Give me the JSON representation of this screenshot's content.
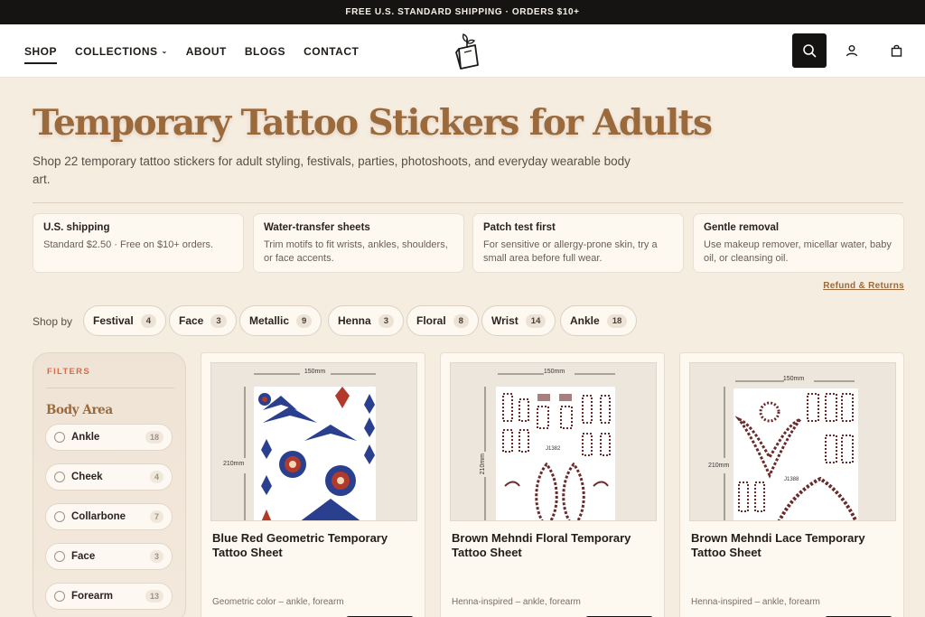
{
  "announcement": "FREE U.S. STANDARD SHIPPING · ORDERS $10+",
  "nav": {
    "items": [
      {
        "label": "SHOP",
        "active": true
      },
      {
        "label": "COLLECTIONS",
        "dropdown": true
      },
      {
        "label": "ABOUT"
      },
      {
        "label": "BLOGS"
      },
      {
        "label": "CONTACT"
      }
    ],
    "icons": {
      "search": "search-icon",
      "account": "user-icon",
      "cart": "bag-icon",
      "logo": "sticker-leaf-logo"
    }
  },
  "page": {
    "title": "Temporary Tattoo Stickers for Adults",
    "subtitle": "Shop 22 temporary tattoo stickers for adult styling, festivals, parties, photoshoots, and everyday wearable body art."
  },
  "info_cards": [
    {
      "title": "U.S. shipping",
      "text": "Standard $2.50 · Free on $10+ orders."
    },
    {
      "title": "Water-transfer sheets",
      "text": "Trim motifs to fit wrists, ankles, shoulders, or face accents."
    },
    {
      "title": "Patch test first",
      "text": "For sensitive or allergy-prone skin, try a small area before full wear."
    },
    {
      "title": "Gentle removal",
      "text": "Use makeup remover, micellar water, baby oil, or cleansing oil."
    }
  ],
  "refund_link": "Refund & Returns",
  "shop_by": {
    "label": "Shop by",
    "chips": [
      {
        "label": "Festival",
        "count": "4"
      },
      {
        "label": "Face",
        "count": "3"
      },
      {
        "label": "Metallic",
        "count": "9"
      },
      {
        "label": "Henna",
        "count": "3"
      },
      {
        "label": "Floral",
        "count": "8"
      },
      {
        "label": "Wrist",
        "count": "14"
      },
      {
        "label": "Ankle",
        "count": "18"
      }
    ]
  },
  "filters": {
    "label": "FILTERS",
    "group_title": "Body Area",
    "options": [
      {
        "label": "Ankle",
        "count": "18"
      },
      {
        "label": "Cheek",
        "count": "4"
      },
      {
        "label": "Collarbone",
        "count": "7"
      },
      {
        "label": "Face",
        "count": "3"
      },
      {
        "label": "Forearm",
        "count": "13"
      }
    ]
  },
  "products": [
    {
      "name": "Blue Red Geometric Temporary Tattoo Sheet",
      "meta": "Geometric color – ankle, forearm",
      "width_label": "150mm",
      "height_label": "210mm",
      "sheet_code": ""
    },
    {
      "name": "Brown Mehndi Floral Temporary Tattoo Sheet",
      "meta": "Henna-inspired – ankle, forearm",
      "width_label": "150mm",
      "height_label": "210mm",
      "sheet_code": "J1382"
    },
    {
      "name": "Brown Mehndi Lace Temporary Tattoo Sheet",
      "meta": "Henna-inspired – ankle, forearm",
      "width_label": "150mm",
      "height_label": "210mm",
      "sheet_code": "J1388"
    }
  ],
  "colors": {
    "accent": "#9a6a3c",
    "dark": "#161412",
    "background": "#f6ede1",
    "filters_label": "#d96a4a",
    "tattoo_blue": "#2b3f8f",
    "tattoo_red": "#b23a2a",
    "tattoo_brown": "#6b2a2a"
  }
}
